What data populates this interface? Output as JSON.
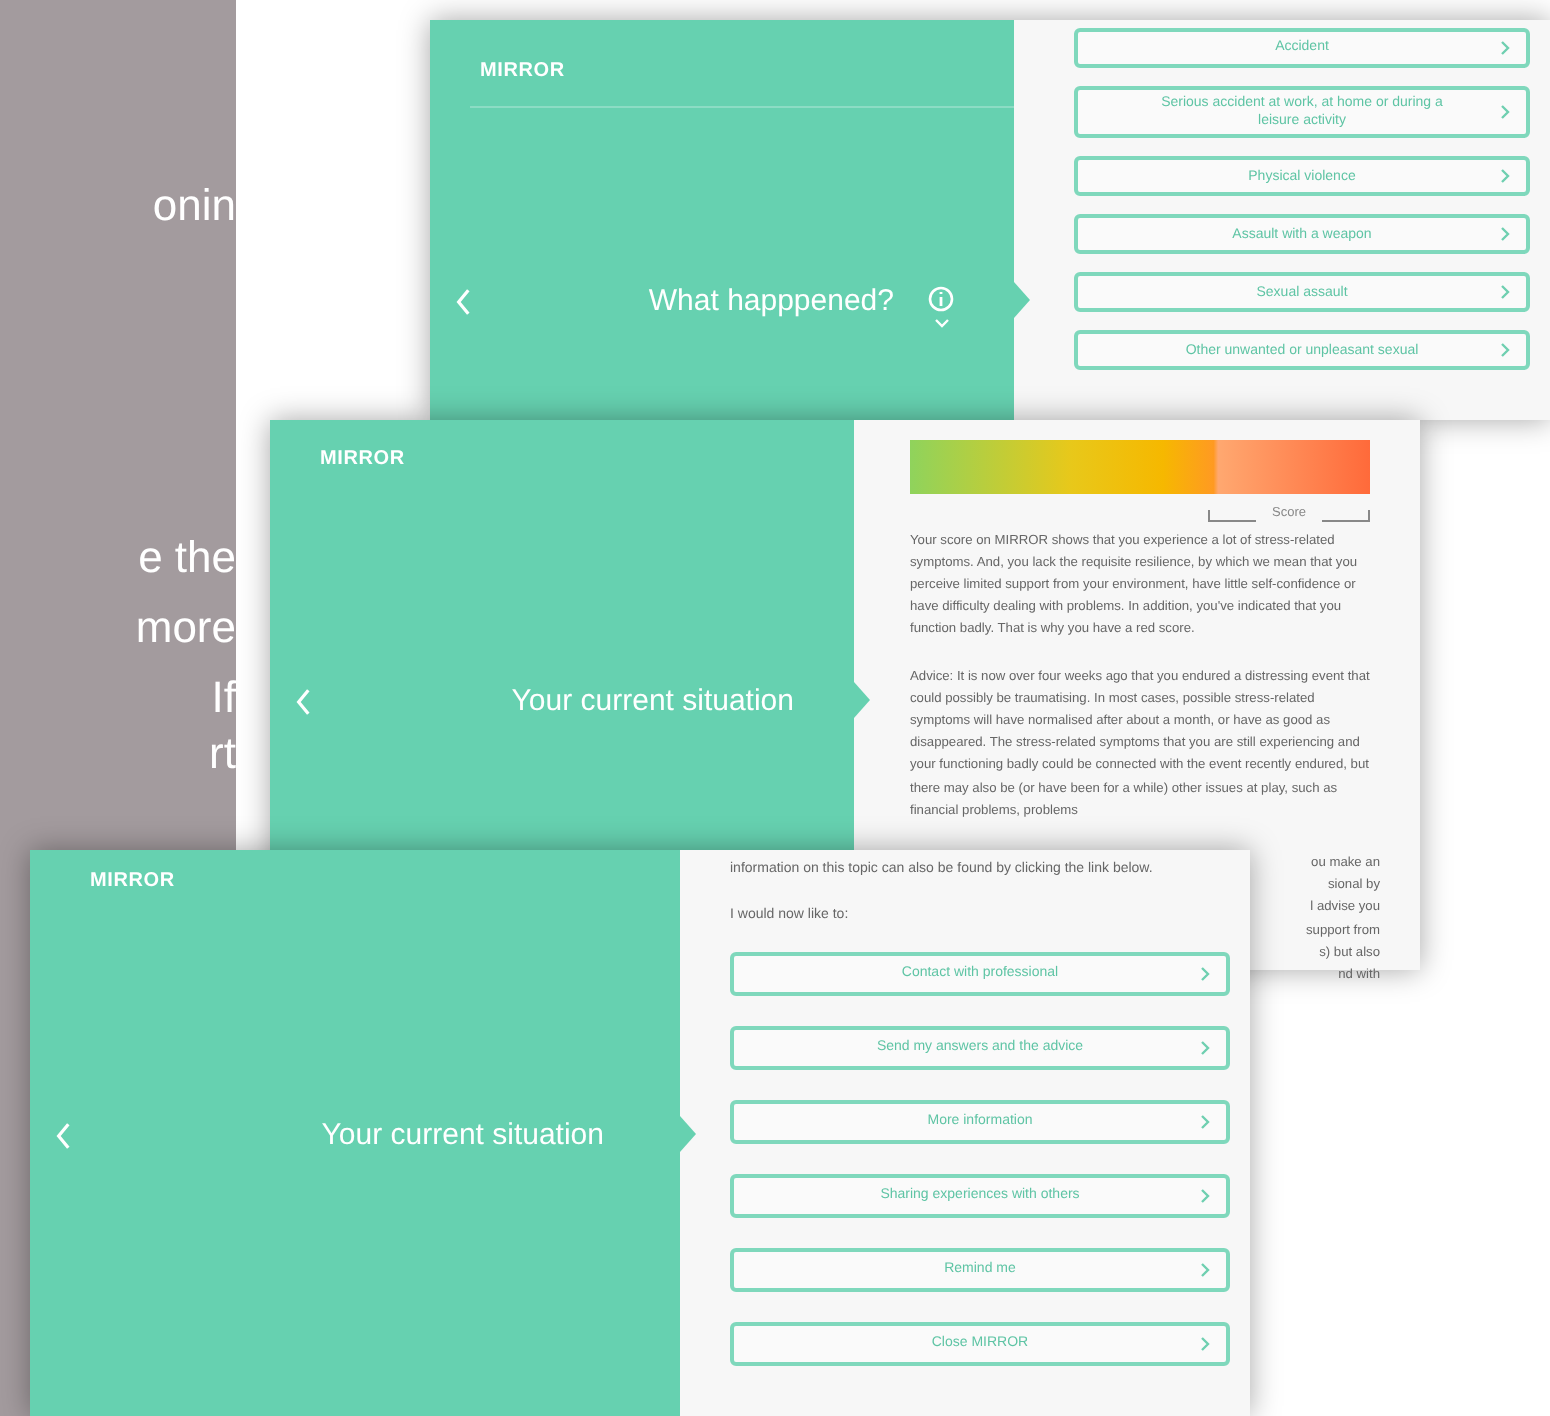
{
  "slide": {
    "text_fragments": [
      "onin",
      "e the",
      "more",
      "If",
      "rt"
    ]
  },
  "windows": [
    {
      "kind": "options",
      "logo": "MIRROR",
      "title": "What happpened?",
      "info": true,
      "options": [
        "Accident",
        "Serious accident at work, at home or during a leisure activity",
        "Physical violence",
        "Assault with a weapon",
        "Sexual assault",
        "Other unwanted or unpleasant sexual"
      ]
    },
    {
      "kind": "advice",
      "logo": "MIRROR",
      "title": "Your current situation",
      "score_label": "Score",
      "paragraphs": [
        "Your score on MIRROR shows that you experience a lot of stress-related symptoms. And, you lack the requisite resilience, by which we mean that you perceive limited support from your environment, have little self-confidence or have difficulty dealing with problems. In addition, you've indicated that you function badly. That is why you have a red score.",
        "Advice: It is now over four weeks ago that you endured a distressing event that could possibly be traumatising. In most cases, possible stress-related symptoms will have normalised after about a month, or have as good as disappeared. The stress-related symptoms that you are still experiencing and your functioning badly could be connected with the event recently endured, but there may also be (or have been for a while) other issues at play, such as financial problems, problems"
      ],
      "line_ends": [
        "ou make an",
        "sional by",
        "l advise you",
        "support from",
        "s) but also",
        "nd with"
      ]
    },
    {
      "kind": "actions",
      "logo": "MIRROR",
      "title": "Your current situation",
      "intro": "information on this topic can also be found by clicking the link below.",
      "prompt": "I would now like to:",
      "options": [
        "Contact with professional",
        "Send my answers and the advice",
        "More information",
        "Sharing experiences with others",
        "Remind me",
        "Close MIRROR"
      ]
    }
  ]
}
